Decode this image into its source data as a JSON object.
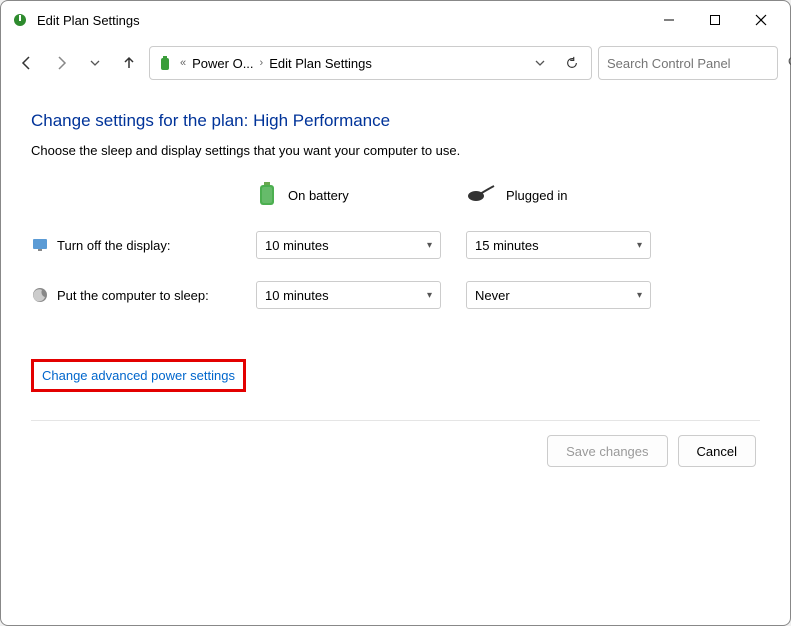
{
  "window": {
    "title": "Edit Plan Settings"
  },
  "breadcrumb": {
    "root": "Power O...",
    "current": "Edit Plan Settings"
  },
  "search": {
    "placeholder": "Search Control Panel"
  },
  "page": {
    "heading": "Change settings for the plan: High Performance",
    "subtext": "Choose the sleep and display settings that you want your computer to use.",
    "column_battery": "On battery",
    "column_plugged": "Plugged in"
  },
  "settings": {
    "display": {
      "label": "Turn off the display:",
      "battery": "10 minutes",
      "plugged": "15 minutes"
    },
    "sleep": {
      "label": "Put the computer to sleep:",
      "battery": "10 minutes",
      "plugged": "Never"
    }
  },
  "links": {
    "advanced": "Change advanced power settings"
  },
  "buttons": {
    "save": "Save changes",
    "cancel": "Cancel"
  }
}
